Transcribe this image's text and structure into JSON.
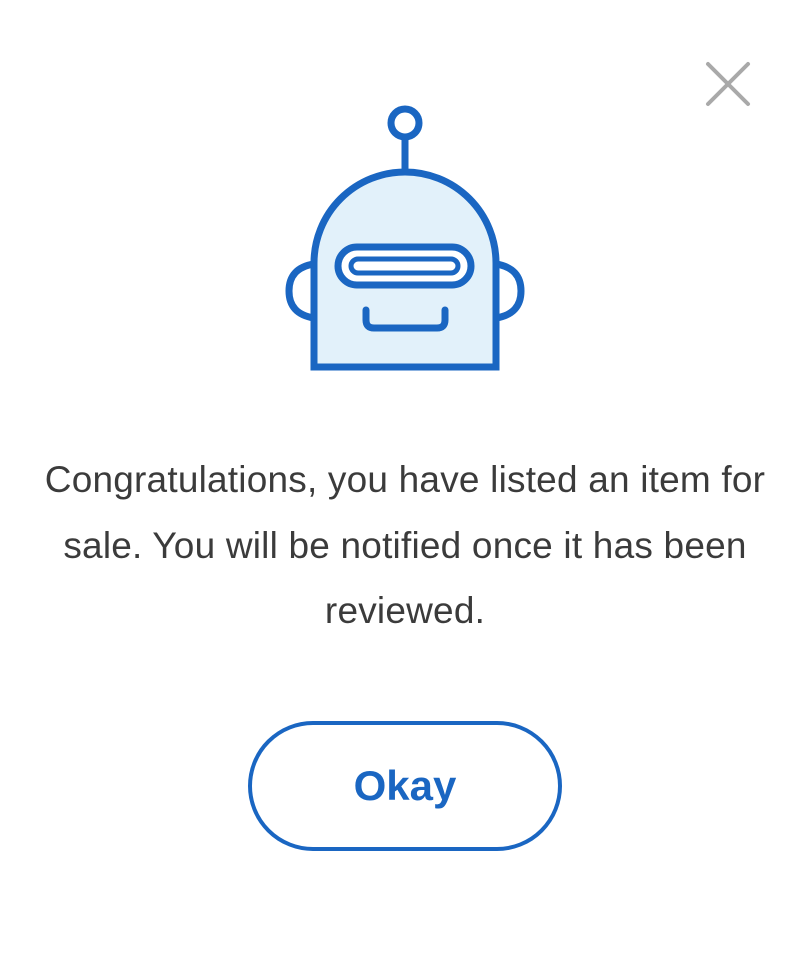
{
  "dialog": {
    "close_icon": "close-icon",
    "illustration_icon": "robot-icon",
    "message": "Congratulations, you have listed an item for sale. You will be notified once it has been reviewed.",
    "okay_label": "Okay"
  },
  "colors": {
    "accent": "#1a66c2",
    "robot_fill": "#e2f1fa",
    "text": "#3b3b3b",
    "close_icon": "#a9a9a9",
    "background": "#ffffff"
  }
}
